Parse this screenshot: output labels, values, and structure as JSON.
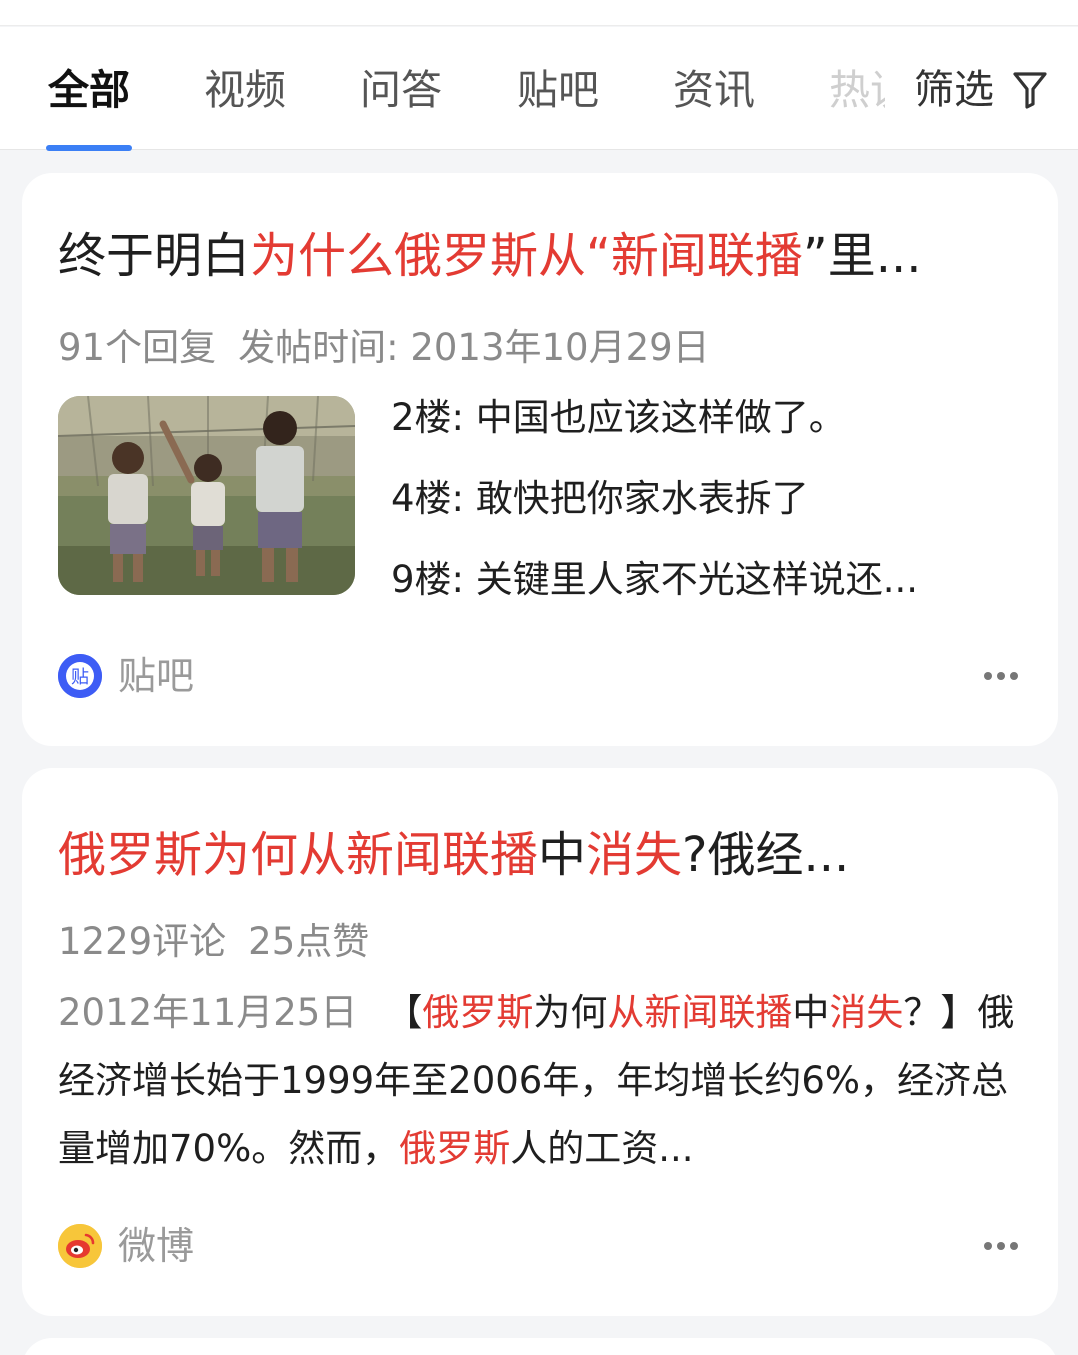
{
  "tabs": {
    "items": [
      "全部",
      "视频",
      "问答",
      "贴吧",
      "资讯",
      "热议"
    ],
    "active_index": 0,
    "filter_label": "筛选",
    "filter_icon": "filter-funnel-icon",
    "accent_color": "#3b7ff5"
  },
  "results": [
    {
      "title_parts": [
        {
          "text": "终于明白",
          "hl": false
        },
        {
          "text": "为什么俄罗斯从“",
          "hl": true
        },
        {
          "text": "新闻联播",
          "hl": true
        },
        {
          "text": "”里...",
          "hl": false
        }
      ],
      "meta": [
        "91个回复",
        "发帖时间: 2013年10月29日"
      ],
      "thumbnail": "three-children-photo",
      "floors": [
        "2楼: 中国也应该这样做了。",
        "4楼: 敢快把你家水表拆了",
        "9楼: 关键里人家不光这样说还..."
      ],
      "source": {
        "label": "贴吧",
        "icon": "tieba-icon",
        "icon_char": "贴",
        "color": "#3d5cf5"
      },
      "more_icon": "more-dots-icon"
    },
    {
      "title_parts": [
        {
          "text": "俄罗斯为何从新闻联播",
          "hl": true
        },
        {
          "text": "中",
          "hl": false
        },
        {
          "text": "消失",
          "hl": true
        },
        {
          "text": "?俄经...",
          "hl": false
        }
      ],
      "meta": [
        "1229评论",
        "25点赞"
      ],
      "snippet_date": "2012年11月25日",
      "snippet_parts": [
        {
          "text": "【",
          "hl": false
        },
        {
          "text": "俄罗斯",
          "hl": true
        },
        {
          "text": "为何",
          "hl": false
        },
        {
          "text": "从新闻联播",
          "hl": true
        },
        {
          "text": "中",
          "hl": false
        },
        {
          "text": "消失",
          "hl": true
        },
        {
          "text": "？】俄经济增长始于1999年至2006年，年均增长约6%，经济总量增加70%。然而，",
          "hl": false
        },
        {
          "text": "俄罗斯",
          "hl": true
        },
        {
          "text": "人的工资...",
          "hl": false
        }
      ],
      "source": {
        "label": "微博",
        "icon": "weibo-icon",
        "color": "#f5b928"
      },
      "more_icon": "more-dots-icon"
    }
  ],
  "highlight_color": "#e33b33"
}
